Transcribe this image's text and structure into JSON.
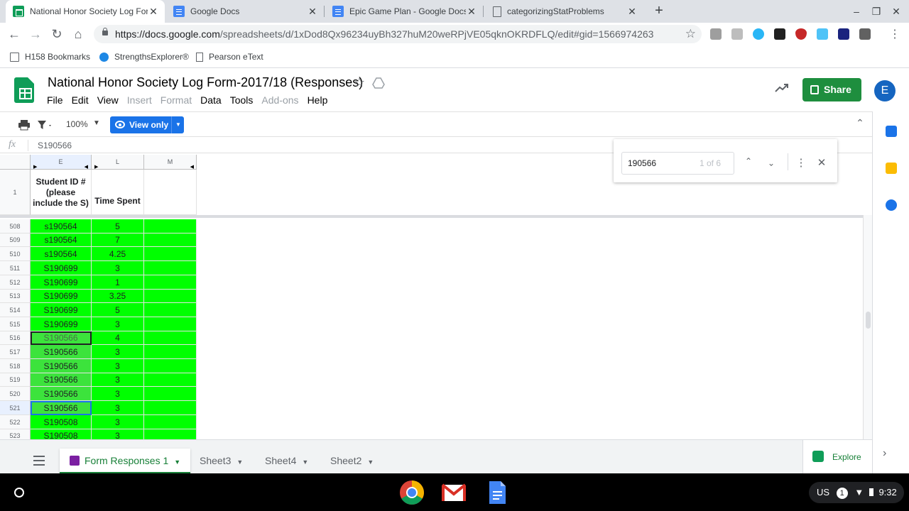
{
  "browser": {
    "tabs": [
      {
        "title": "National Honor Society Log Form",
        "icon": "sheets-icon",
        "active": true
      },
      {
        "title": "Google Docs",
        "icon": "docs-icon",
        "active": false
      },
      {
        "title": "Epic Game Plan - Google Docs",
        "icon": "docs-icon",
        "active": false
      },
      {
        "title": "categorizingStatProblems",
        "icon": "document-icon",
        "active": false
      }
    ],
    "url_host": "https://docs.google.com",
    "url_path": "/spreadsheets/d/1xDod8Qx96234uyBh327huM20weRPjVE05qknOKRDFLQ/edit#gid=1566974263",
    "bookmarks": [
      {
        "label": "H158 Bookmarks",
        "icon": "folder-icon"
      },
      {
        "label": "StrengthsExplorer®",
        "icon": "globe-icon"
      },
      {
        "label": "Pearson eText",
        "icon": "page-icon"
      }
    ]
  },
  "doc": {
    "title": "National Honor Society Log Form-2017/18 (Responses)",
    "menu": [
      {
        "label": "File",
        "enabled": true
      },
      {
        "label": "Edit",
        "enabled": true
      },
      {
        "label": "View",
        "enabled": true
      },
      {
        "label": "Insert",
        "enabled": false
      },
      {
        "label": "Format",
        "enabled": false
      },
      {
        "label": "Data",
        "enabled": true
      },
      {
        "label": "Tools",
        "enabled": true
      },
      {
        "label": "Add-ons",
        "enabled": false
      },
      {
        "label": "Help",
        "enabled": true
      }
    ],
    "share_label": "Share",
    "avatar_initial": "E"
  },
  "toolbar": {
    "zoom": "100%",
    "view_only_label": "View only"
  },
  "formula_bar": {
    "fx": "fx",
    "content": "S190566"
  },
  "find": {
    "query": "190566",
    "count": "1 of 6"
  },
  "grid": {
    "columns": [
      "E",
      "L",
      "M"
    ],
    "header_row_number": "1",
    "header_cells": [
      "Student ID # (please include the S)",
      "Time Spent",
      ""
    ],
    "rows": [
      {
        "num": "508",
        "id": "s190564",
        "time": "5"
      },
      {
        "num": "509",
        "id": "s190564",
        "time": "7"
      },
      {
        "num": "510",
        "id": "s190564",
        "time": "4.25"
      },
      {
        "num": "511",
        "id": "S190699",
        "time": "3"
      },
      {
        "num": "512",
        "id": "S190699",
        "time": "1"
      },
      {
        "num": "513",
        "id": "S190699",
        "time": "3.25"
      },
      {
        "num": "514",
        "id": "S190699",
        "time": "5"
      },
      {
        "num": "515",
        "id": "S190699",
        "time": "3"
      },
      {
        "num": "516",
        "id": "S190566",
        "time": "4"
      },
      {
        "num": "517",
        "id": "S190566",
        "time": "3"
      },
      {
        "num": "518",
        "id": "S190566",
        "time": "3"
      },
      {
        "num": "519",
        "id": "S190566",
        "time": "3"
      },
      {
        "num": "520",
        "id": "S190566",
        "time": "3"
      },
      {
        "num": "521",
        "id": "S190566",
        "time": "3"
      },
      {
        "num": "522",
        "id": "S190508",
        "time": "3"
      },
      {
        "num": "523",
        "id": "S190508",
        "time": "3"
      }
    ],
    "fill_color": "#00ff00",
    "match_highlight_color": "#3ce33c"
  },
  "sheet_tabs": [
    {
      "label": "Form Responses 1",
      "active": true
    },
    {
      "label": "Sheet3",
      "active": false
    },
    {
      "label": "Sheet4",
      "active": false
    },
    {
      "label": "Sheet2",
      "active": false
    }
  ],
  "explore_label": "Explore",
  "shelf": {
    "apps": [
      "chrome-icon",
      "gmail-icon",
      "docs-icon"
    ],
    "ime": "US",
    "notifications": "1",
    "time": "9:32"
  },
  "colors": {
    "sheets_green": "#0f9d58",
    "share_green": "#1e8e3e",
    "view_only_blue": "#1a73e8",
    "avatar_blue": "#1565c0"
  }
}
